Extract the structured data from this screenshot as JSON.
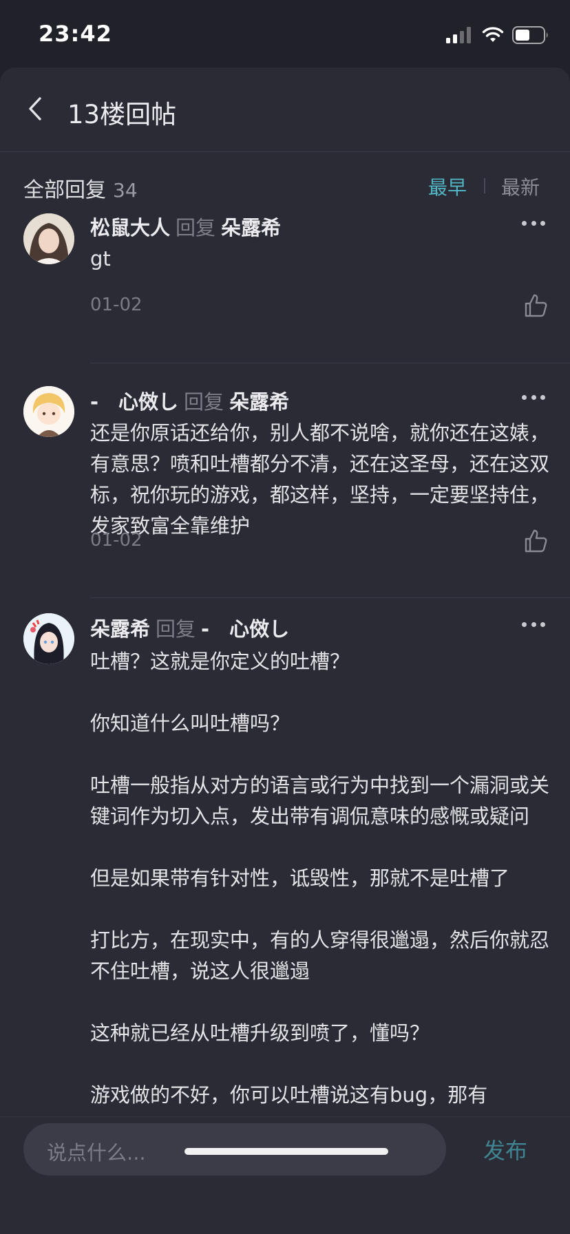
{
  "status_bar": {
    "time": "23:42"
  },
  "nav": {
    "title": "13楼回帖"
  },
  "filter": {
    "all_label": "全部回复",
    "count": "34",
    "sort_earliest": "最早",
    "sort_newest": "最新"
  },
  "replies": [
    {
      "user": "松鼠大人",
      "reply_word": "回复",
      "target": "朵露希",
      "body": [
        "gt"
      ],
      "date": "01-02"
    },
    {
      "user": "-　心傚し",
      "reply_word": "回复",
      "target": "朵露希",
      "body": [
        "还是你原话还给你，别人都不说啥，就你还在这婊，有意思？喷和吐槽都分不清，还在这圣母，还在这双标，祝你玩的游戏，都这样，坚持，一定要坚持住，发家致富全靠维护"
      ],
      "date": "01-02"
    },
    {
      "user": "朵露希",
      "reply_word": "回复",
      "target": "-　心傚し",
      "body": [
        "吐槽？这就是你定义的吐槽？",
        "你知道什么叫吐槽吗？",
        "吐槽一般指从对方的语言或行为中找到一个漏洞或关键词作为切入点，发出带有调侃意味的感慨或疑问",
        "但是如果带有针对性，诋毁性，那就不是吐槽了",
        "打比方，在现实中，有的人穿得很邋遢，然后你就忍不住吐槽，说这人很邋遢",
        "这种就已经从吐槽升级到喷了，懂吗？",
        "游戏做的不好，你可以吐槽说这有bug，那有"
      ]
    }
  ],
  "input": {
    "placeholder": "说点什么...",
    "publish": "发布"
  },
  "colors": {
    "accent": "#52b5c3",
    "background": "#2a2b35",
    "status_bg": "#212129"
  }
}
